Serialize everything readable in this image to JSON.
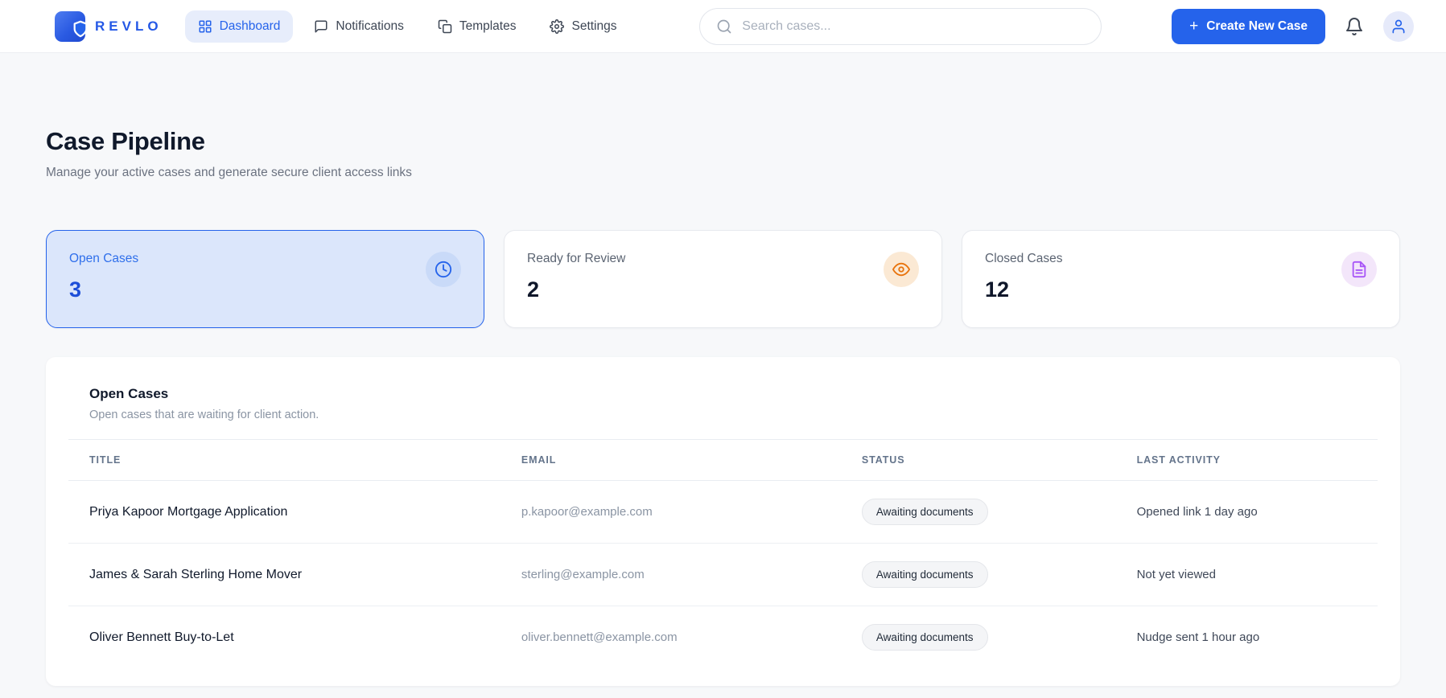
{
  "header": {
    "brand": "REVLO",
    "nav_items": [
      {
        "label": "Dashboard",
        "icon": "grid",
        "active": true
      },
      {
        "label": "Notifications",
        "icon": "chat",
        "active": false
      },
      {
        "label": "Templates",
        "icon": "copy",
        "active": false
      },
      {
        "label": "Settings",
        "icon": "gear",
        "active": false
      }
    ],
    "search": {
      "placeholder": "Search cases..."
    },
    "create_button": {
      "label": "Create New Case",
      "icon": "plus"
    }
  },
  "page": {
    "title": "Case Pipeline",
    "subtitle": "Manage your active cases and generate secure client access links"
  },
  "stats": [
    {
      "label": "Open Cases",
      "value": "3",
      "icon": "clock",
      "selected": true
    },
    {
      "label": "Ready for Review",
      "value": "2",
      "icon": "eye",
      "selected": false
    },
    {
      "label": "Closed Cases",
      "value": "12",
      "icon": "document",
      "selected": false
    }
  ],
  "table": {
    "title": "Open Cases",
    "subtitle": "Open cases that are waiting for client action.",
    "columns": [
      "TITLE",
      "EMAIL",
      "STATUS",
      "LAST ACTIVITY"
    ],
    "rows": [
      {
        "title": "Priya Kapoor Mortgage Application",
        "email": "p.kapoor@example.com",
        "status": "Awaiting documents",
        "last_activity": "Opened link 1 day ago"
      },
      {
        "title": "James & Sarah Sterling Home Mover",
        "email": "sterling@example.com",
        "status": "Awaiting documents",
        "last_activity": "Not yet viewed"
      },
      {
        "title": "Oliver Bennett Buy-to-Let",
        "email": "oliver.bennett@example.com",
        "status": "Awaiting documents",
        "last_activity": "Nudge sent 1 hour ago"
      }
    ]
  },
  "colors": {
    "accent_blue": "#2563eb",
    "active_card_bg": "#dbe6fb",
    "active_card_number": "#1d4ed8",
    "clock_circle_bg": "#c9daf8",
    "eye_orange": "#e8730c",
    "eye_circle_bg": "#fbe9d4",
    "doc_purple": "#a855f7",
    "doc_circle_bg": "#f3e6fa",
    "badge_bg": "#f4f5f7",
    "page_bg": "#f7f8fa"
  }
}
